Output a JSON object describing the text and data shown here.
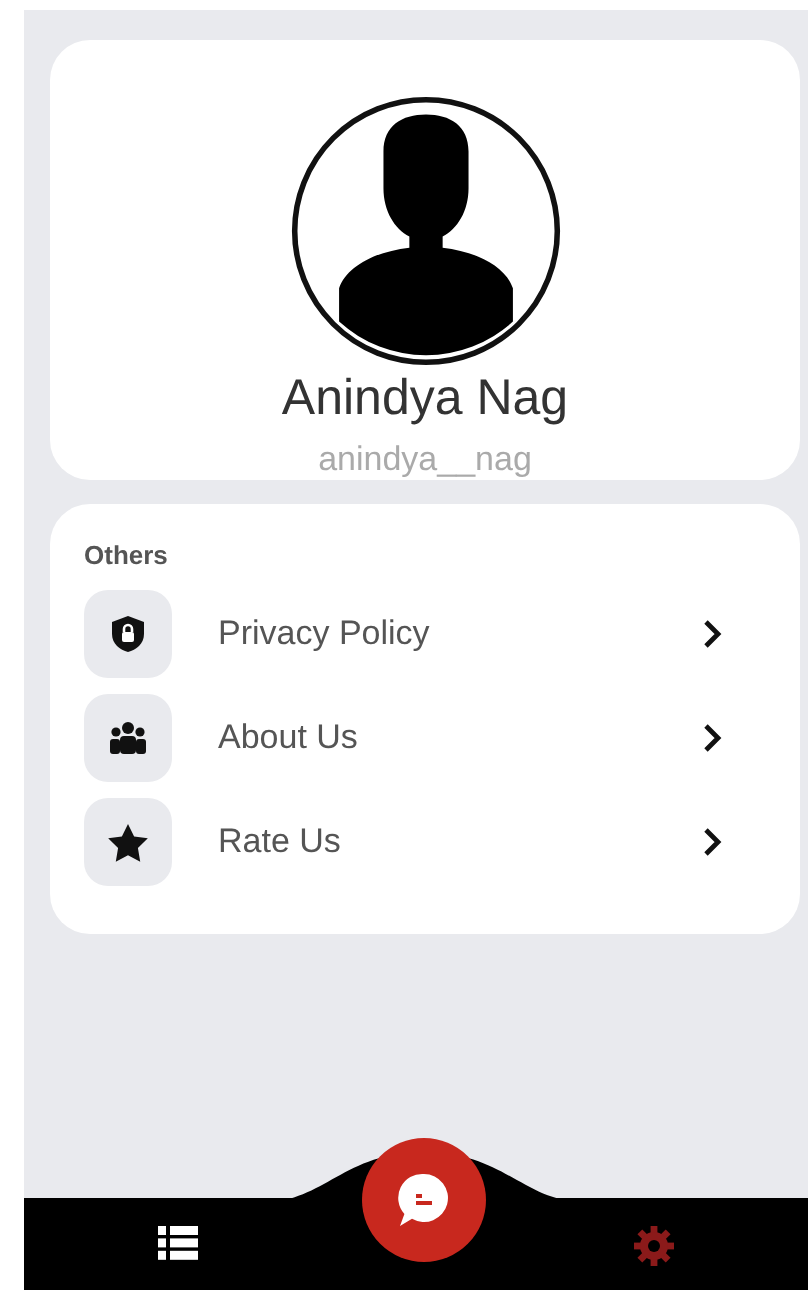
{
  "profile": {
    "name": "Anindya Nag",
    "username": "anindya__nag"
  },
  "section": {
    "title": "Others",
    "items": [
      {
        "label": "Privacy Policy",
        "kind": "shield"
      },
      {
        "label": "About Us",
        "kind": "group"
      },
      {
        "label": "Rate Us",
        "kind": "star"
      }
    ]
  },
  "bottom_nav": [
    {
      "kind": "list",
      "selected": false
    },
    {
      "kind": "chat",
      "selected": false
    },
    {
      "kind": "settings",
      "selected": true
    }
  ]
}
